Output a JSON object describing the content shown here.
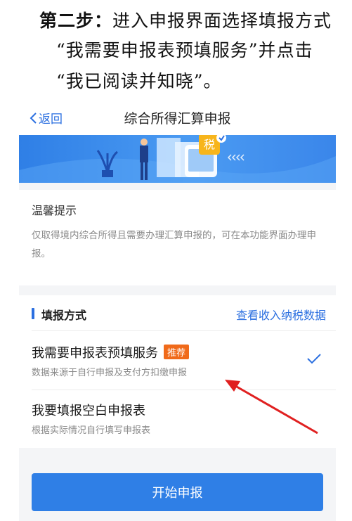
{
  "instruction": {
    "step_label": "第二步：",
    "line1_rest": "进入申报界面选择填报方式",
    "line2": "“我需要申报表预填服务”并点击",
    "line3": "“我已阅读并知晓”。"
  },
  "nav": {
    "back_label": "返回",
    "title": "综合所得汇算申报"
  },
  "banner": {
    "tax_char": "税"
  },
  "tips": {
    "title": "温馨提示",
    "text": "仅取得境内综合所得且需要办理汇算申报的，可在本功能界面办理申报。"
  },
  "section": {
    "title": "填报方式",
    "link": "查看收入纳税数据"
  },
  "options": [
    {
      "title": "我需要申报表预填服务",
      "badge": "推荐",
      "subtitle": "数据来源于自行申报及支付方扣缴申报",
      "selected": true
    },
    {
      "title": "我要填报空白申报表",
      "subtitle": "根据实际情况自行填写申报表",
      "selected": false
    }
  ],
  "start_button": "开始申报",
  "colors": {
    "accent": "#2b6fe0",
    "badge": "#f06a1a",
    "arrow": "#e02020"
  }
}
